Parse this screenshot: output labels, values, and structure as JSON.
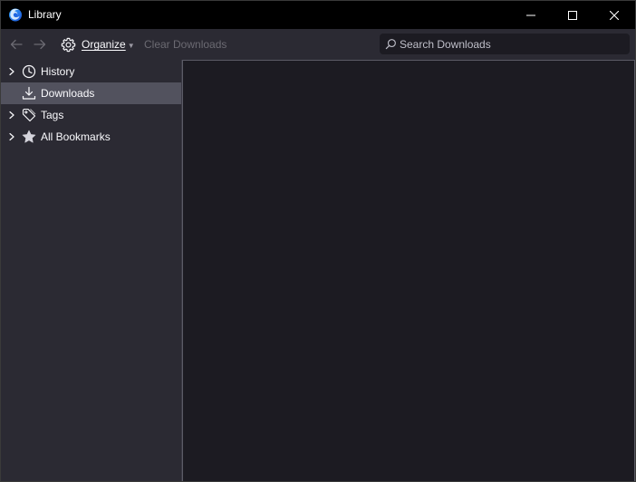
{
  "window": {
    "title": "Library",
    "icon": "firefox-logo-icon",
    "controls": [
      "minimize-icon",
      "maximize-icon",
      "close-icon"
    ]
  },
  "toolbar": {
    "back_icon": "arrow-left-icon",
    "forward_icon": "arrow-right-icon",
    "organize_label": "Organize",
    "organize_icon": "gear-icon",
    "clear_downloads_label": "Clear Downloads",
    "search": {
      "placeholder": "Search Downloads",
      "value": "",
      "icon": "search-icon"
    }
  },
  "sidebar": {
    "items": [
      {
        "label": "History",
        "icon": "clock-icon",
        "expandable": true,
        "selected": false
      },
      {
        "label": "Downloads",
        "icon": "download-icon",
        "expandable": false,
        "selected": true
      },
      {
        "label": "Tags",
        "icon": "tag-icon",
        "expandable": true,
        "selected": false
      },
      {
        "label": "All Bookmarks",
        "icon": "star-icon",
        "expandable": true,
        "selected": false
      }
    ]
  },
  "colors": {
    "titlebar": "#000000",
    "toolbar": "#2b2a33",
    "sidebar": "#2b2a33",
    "selected_item": "#52525e",
    "content": "#1c1b22",
    "text": "#fbfbfe",
    "disabled_text": "#6b6a72"
  }
}
